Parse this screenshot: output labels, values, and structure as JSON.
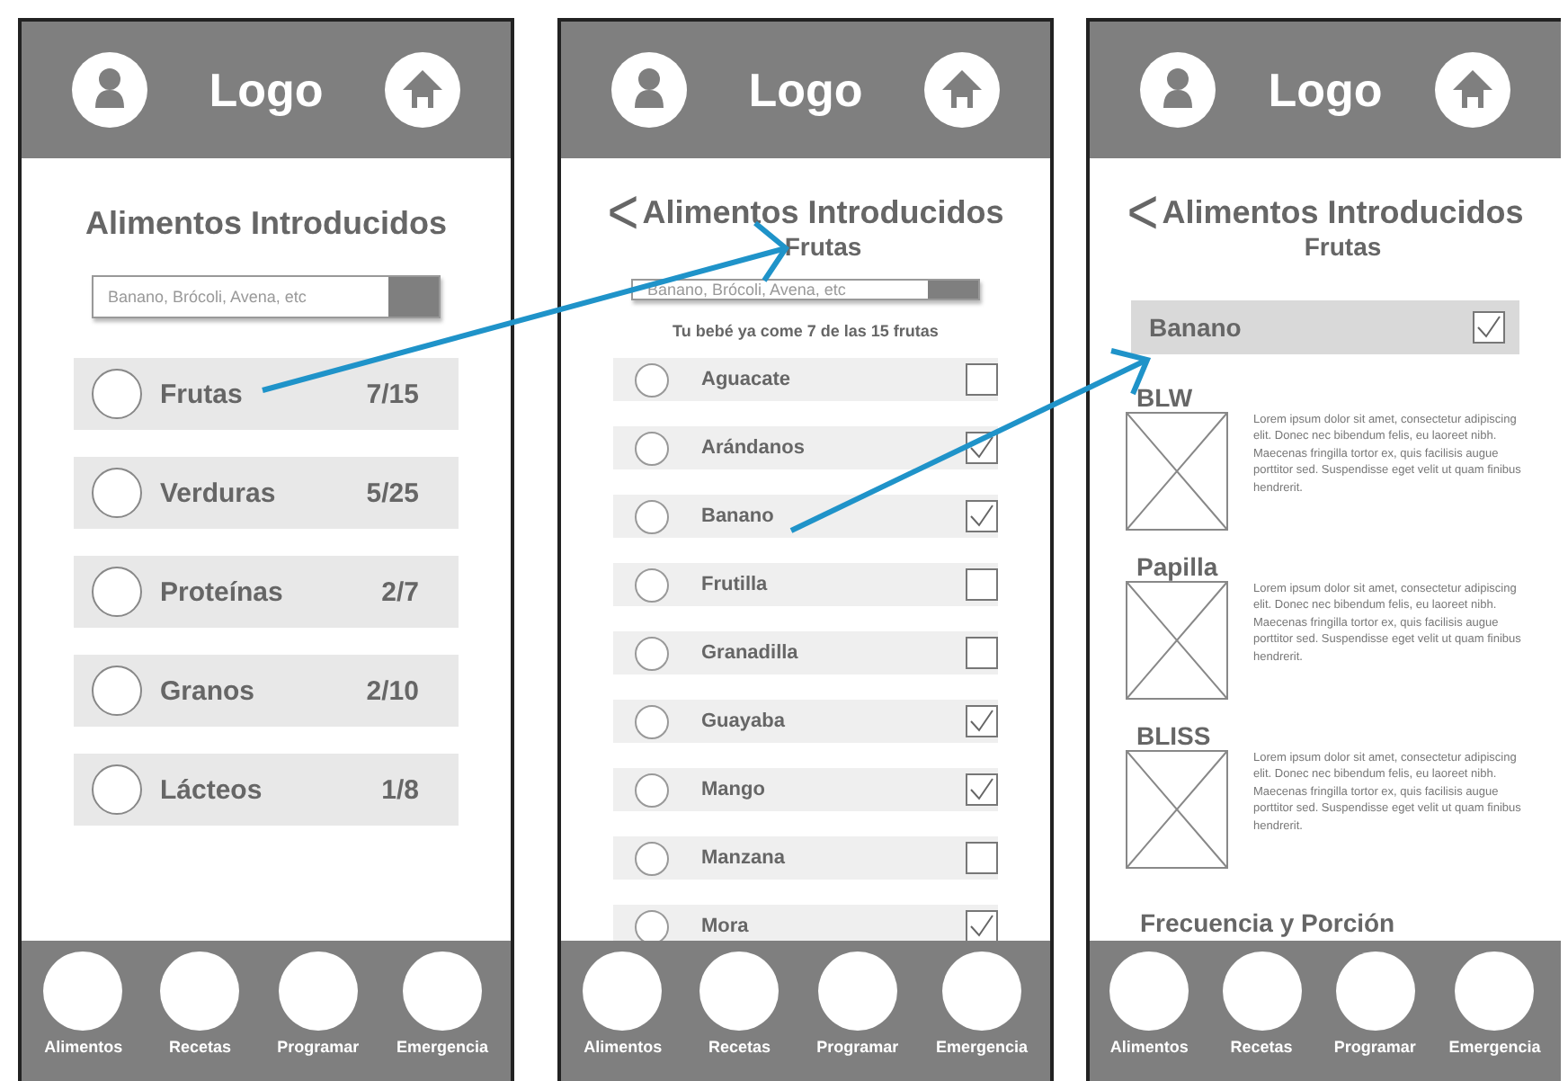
{
  "screens": [
    {
      "kind": "categories",
      "logo": "Logo",
      "title": "Alimentos Introducidos",
      "search": {
        "placeholder": "Banano, Brócoli, Avena, etc"
      },
      "categories": [
        {
          "name": "Frutas",
          "count": "7/15"
        },
        {
          "name": "Verduras",
          "count": "5/25"
        },
        {
          "name": "Proteínas",
          "count": "2/7"
        },
        {
          "name": "Granos",
          "count": "2/10"
        },
        {
          "name": "Lácteos",
          "count": "1/8"
        }
      ],
      "nav": [
        "Alimentos",
        "Recetas",
        "Programar",
        "Emergencia"
      ]
    },
    {
      "kind": "foods",
      "logo": "Logo",
      "back": "<",
      "title": "Alimentos Introducidos",
      "subtitle": "Frutas",
      "search": {
        "placeholder": "Banano, Brócoli, Avena, etc"
      },
      "note": "Tu bebé ya come 7 de las 15 frutas",
      "foods": [
        {
          "name": "Aguacate",
          "checked": false
        },
        {
          "name": "Arándanos",
          "checked": true
        },
        {
          "name": "Banano",
          "checked": true
        },
        {
          "name": "Frutilla",
          "checked": false
        },
        {
          "name": "Granadilla",
          "checked": false
        },
        {
          "name": "Guayaba",
          "checked": true
        },
        {
          "name": "Mango",
          "checked": true
        },
        {
          "name": "Manzana",
          "checked": false
        },
        {
          "name": "Mora",
          "checked": true
        }
      ],
      "nav": [
        "Alimentos",
        "Recetas",
        "Programar",
        "Emergencia"
      ]
    },
    {
      "kind": "detail",
      "logo": "Logo",
      "back": "<",
      "title": "Alimentos Introducidos",
      "subtitle": "Frutas",
      "food": {
        "name": "Banano",
        "checked": true
      },
      "sections": [
        {
          "heading": "BLW",
          "text": "Lorem ipsum dolor sit amet, consectetur adipiscing elit. Donec nec bibendum felis, eu laoreet nibh. Maecenas fringilla tortor ex, quis facilisis augue porttitor sed. Suspendisse eget velit ut quam finibus hendrerit."
        },
        {
          "heading": "Papilla",
          "text": "Lorem ipsum dolor sit amet, consectetur adipiscing elit. Donec nec bibendum felis, eu laoreet nibh. Maecenas fringilla tortor ex, quis facilisis augue porttitor sed. Suspendisse eget velit ut quam finibus hendrerit."
        },
        {
          "heading": "BLISS",
          "text": "Lorem ipsum dolor sit amet, consectetur adipiscing elit. Donec nec bibendum felis, eu laoreet nibh. Maecenas fringilla tortor ex, quis facilisis augue porttitor sed. Suspendisse eget velit ut quam finibus hendrerit."
        }
      ],
      "footer_heading": "Frecuencia y Porción",
      "nav": [
        "Alimentos",
        "Recetas",
        "Programar",
        "Emergencia"
      ]
    }
  ]
}
